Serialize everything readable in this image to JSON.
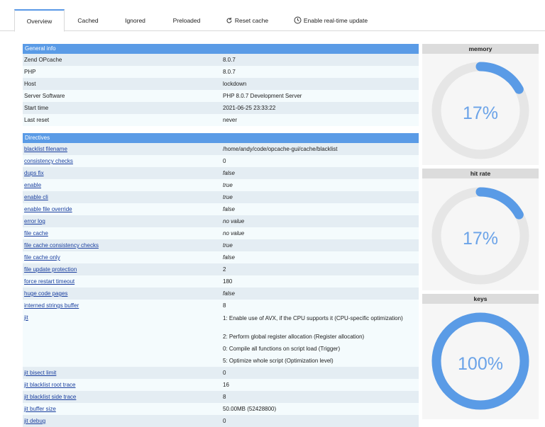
{
  "tabs": [
    {
      "label": "Overview",
      "active": true
    },
    {
      "label": "Cached"
    },
    {
      "label": "Ignored"
    },
    {
      "label": "Preloaded"
    },
    {
      "label": "Reset cache",
      "icon": "reload-icon"
    },
    {
      "label": "Enable real-time update",
      "icon": "clock-icon"
    }
  ],
  "general": {
    "title": "General info",
    "rows": [
      {
        "k": "Zend OPcache",
        "v": "8.0.7"
      },
      {
        "k": "PHP",
        "v": "8.0.7"
      },
      {
        "k": "Host",
        "v": "lockdown"
      },
      {
        "k": "Server Software",
        "v": "PHP 8.0.7 Development Server"
      },
      {
        "k": "Start time",
        "v": "2021-06-25 23:33:22"
      },
      {
        "k": "Last reset",
        "v": "never"
      }
    ]
  },
  "directives": {
    "title": "Directives",
    "rows": [
      {
        "k": "blacklist filename",
        "v": "/home/andy/code/opcache-gui/cache/blacklist"
      },
      {
        "k": "consistency checks",
        "v": "0"
      },
      {
        "k": "dups fix",
        "v": "false",
        "italic": true
      },
      {
        "k": "enable",
        "v": "true",
        "italic": true
      },
      {
        "k": "enable cli",
        "v": "true",
        "italic": true
      },
      {
        "k": "enable file override",
        "v": "false",
        "italic": true
      },
      {
        "k": "error log",
        "v": "no value",
        "italic": true
      },
      {
        "k": "file cache",
        "v": "no value",
        "italic": true
      },
      {
        "k": "file cache consistency checks",
        "v": "true",
        "italic": true
      },
      {
        "k": "file cache only",
        "v": "false",
        "italic": true
      },
      {
        "k": "file update protection",
        "v": "2"
      },
      {
        "k": "force restart timeout",
        "v": "180"
      },
      {
        "k": "huge code pages",
        "v": "false",
        "italic": true
      },
      {
        "k": "interned strings buffer",
        "v": "8"
      }
    ],
    "jit": {
      "k": "jit",
      "lines": [
        "1: Enable use of AVX, if the CPU supports it (CPU-specific optimization)",
        "2: Perform global register allocation (Register allocation)",
        "0: Compile all functions on script load (Trigger)",
        "5: Optimize whole script (Optimization level)"
      ]
    },
    "rows_after": [
      {
        "k": "jit bisect limit",
        "v": "0"
      },
      {
        "k": "jit blacklist root trace",
        "v": "16"
      },
      {
        "k": "jit blacklist side trace",
        "v": "8"
      },
      {
        "k": "jit buffer size",
        "v": "50.00MB (52428800)"
      },
      {
        "k": "jit debug",
        "v": "0"
      }
    ]
  },
  "gauges": [
    {
      "title": "memory",
      "value": 17,
      "label": "17%"
    },
    {
      "title": "hit rate",
      "value": 17,
      "label": "17%"
    },
    {
      "title": "keys",
      "value": 100,
      "label": "100%"
    }
  ],
  "colors": {
    "accent": "#5a9be6",
    "track": "#e6e6e6",
    "gauge_text": "#6ba3e8"
  }
}
